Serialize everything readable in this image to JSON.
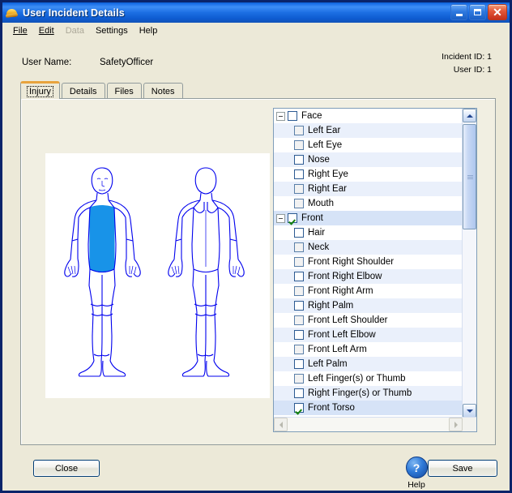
{
  "window": {
    "title": "User Incident Details",
    "icon": "hardhat-icon",
    "controls": {
      "minimize": "Minimize",
      "maximize": "Maximize",
      "close": "Close"
    }
  },
  "menu": {
    "items": [
      {
        "label": "File",
        "disabled": false
      },
      {
        "label": "Edit",
        "disabled": false
      },
      {
        "label": "Data",
        "disabled": true
      },
      {
        "label": "Settings",
        "disabled": false
      },
      {
        "label": "Help",
        "disabled": false
      }
    ]
  },
  "header": {
    "username_label": "User Name:",
    "username_value": "SafetyOfficer",
    "incident_id": "Incident ID: 1",
    "user_id": "User ID: 1"
  },
  "tabs": [
    {
      "label": "Injury",
      "active": true
    },
    {
      "label": "Details",
      "active": false
    },
    {
      "label": "Files",
      "active": false
    },
    {
      "label": "Notes",
      "active": false
    }
  ],
  "body_diagram": {
    "alt": "Front and back human body diagrams",
    "outline_color": "#0000ee",
    "highlight_color": "#1893e8",
    "highlighted_region": "Front Torso"
  },
  "tree": {
    "rows": [
      {
        "label": "Face",
        "level": 0,
        "expander": "minus",
        "checked": false,
        "dim": false,
        "selected": false
      },
      {
        "label": "Left Ear",
        "level": 1,
        "expander": "",
        "checked": false,
        "dim": true,
        "selected": false
      },
      {
        "label": "Left Eye",
        "level": 1,
        "expander": "",
        "checked": false,
        "dim": true,
        "selected": false
      },
      {
        "label": "Nose",
        "level": 1,
        "expander": "",
        "checked": false,
        "dim": false,
        "selected": false
      },
      {
        "label": "Right Eye",
        "level": 1,
        "expander": "",
        "checked": false,
        "dim": false,
        "selected": false
      },
      {
        "label": "Right Ear",
        "level": 1,
        "expander": "",
        "checked": false,
        "dim": true,
        "selected": false
      },
      {
        "label": "Mouth",
        "level": 1,
        "expander": "",
        "checked": false,
        "dim": true,
        "selected": false
      },
      {
        "label": "Front",
        "level": 0,
        "expander": "minus",
        "checked": true,
        "dim": false,
        "selected": true
      },
      {
        "label": "Hair",
        "level": 1,
        "expander": "",
        "checked": false,
        "dim": false,
        "selected": false
      },
      {
        "label": "Neck",
        "level": 1,
        "expander": "",
        "checked": false,
        "dim": true,
        "selected": false
      },
      {
        "label": "Front Right Shoulder",
        "level": 1,
        "expander": "",
        "checked": false,
        "dim": true,
        "selected": false
      },
      {
        "label": "Front Right Elbow",
        "level": 1,
        "expander": "",
        "checked": false,
        "dim": false,
        "selected": false
      },
      {
        "label": "Front Right Arm",
        "level": 1,
        "expander": "",
        "checked": false,
        "dim": true,
        "selected": false
      },
      {
        "label": "Right Palm",
        "level": 1,
        "expander": "",
        "checked": false,
        "dim": false,
        "selected": false
      },
      {
        "label": "Front Left Shoulder",
        "level": 1,
        "expander": "",
        "checked": false,
        "dim": true,
        "selected": false
      },
      {
        "label": "Front Left Elbow",
        "level": 1,
        "expander": "",
        "checked": false,
        "dim": false,
        "selected": false
      },
      {
        "label": "Front Left Arm",
        "level": 1,
        "expander": "",
        "checked": false,
        "dim": true,
        "selected": false
      },
      {
        "label": "Left Palm",
        "level": 1,
        "expander": "",
        "checked": false,
        "dim": false,
        "selected": false
      },
      {
        "label": "Left Finger(s) or Thumb",
        "level": 1,
        "expander": "",
        "checked": false,
        "dim": true,
        "selected": false
      },
      {
        "label": "Right Finger(s) or Thumb",
        "level": 1,
        "expander": "",
        "checked": false,
        "dim": false,
        "selected": false
      },
      {
        "label": "Front Torso",
        "level": 1,
        "expander": "",
        "checked": true,
        "dim": false,
        "selected": true
      }
    ],
    "vertical_scrollbar": {
      "thumb_top_pct": 5,
      "thumb_height_pct": 34
    },
    "horizontal_scrollbar": {
      "enabled": false
    }
  },
  "footer": {
    "close_label": "Close",
    "save_label": "Save",
    "help_label": "Help",
    "help_glyph": "?"
  }
}
